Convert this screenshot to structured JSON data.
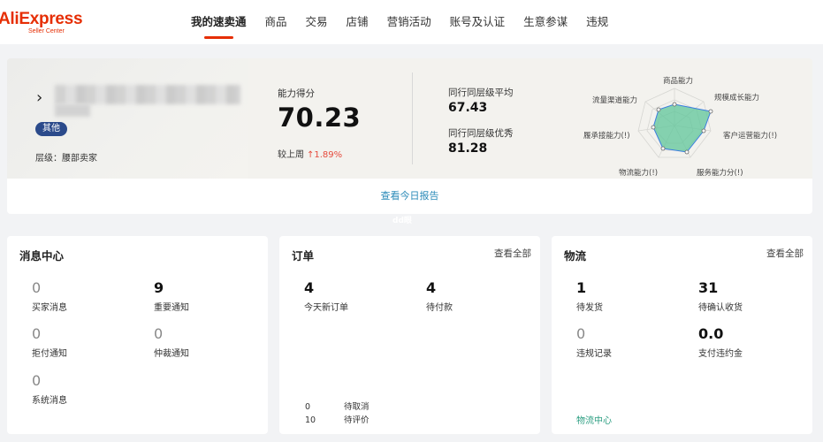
{
  "brand": {
    "logo": "AliExpress",
    "logo_sub": "Seller Center",
    "color": "#e62e04"
  },
  "nav": {
    "items": [
      "我的速卖通",
      "商品",
      "交易",
      "店铺",
      "营销活动",
      "账号及认证",
      "生意参谋",
      "违规"
    ],
    "active": 0
  },
  "score": {
    "badge": "其他",
    "level": "层级：腰部卖家",
    "ability_label": "能力得分",
    "ability_value": "70.23",
    "week_prefix": "较上周",
    "week_change": "↑1.89%",
    "peer_avg_label": "同行同层级平均",
    "peer_avg_value": "67.43",
    "peer_top_label": "同行同层级优秀",
    "peer_top_value": "81.28",
    "report_link": "查看今日报告"
  },
  "radar": {
    "axes": [
      "商品能力",
      "规模成长能力",
      "客户运营能力(!)",
      "服务能力分(!)",
      "物流能力(!)",
      "履承接能力(!)",
      "流量渠道能力"
    ],
    "fill_color": "#5fc59a",
    "line_color": "#3b7de0"
  },
  "watermark": "dd眼",
  "messages": {
    "title": "消息中心",
    "stats": [
      {
        "value": "0",
        "label": "买家消息"
      },
      {
        "value": "9",
        "label": "重要通知"
      },
      {
        "value": "0",
        "label": "拒付通知"
      },
      {
        "value": "0",
        "label": "仲裁通知"
      },
      {
        "value": "0",
        "label": "系统消息"
      }
    ]
  },
  "orders": {
    "title": "订单",
    "more": "查看全部",
    "stats": [
      {
        "value": "4",
        "label": "今天新订单"
      },
      {
        "value": "4",
        "label": "待付款"
      }
    ],
    "minor": [
      {
        "value": "0",
        "label": "待取消"
      },
      {
        "value": "10",
        "label": "待评价"
      }
    ]
  },
  "logistics": {
    "title": "物流",
    "more": "查看全部",
    "stats": [
      {
        "value": "1",
        "label": "待发货"
      },
      {
        "value": "31",
        "label": "待确认收货"
      },
      {
        "value": "0",
        "label": "违规记录"
      },
      {
        "value": "0.0",
        "label": "支付违约金"
      }
    ],
    "link": "物流中心"
  }
}
